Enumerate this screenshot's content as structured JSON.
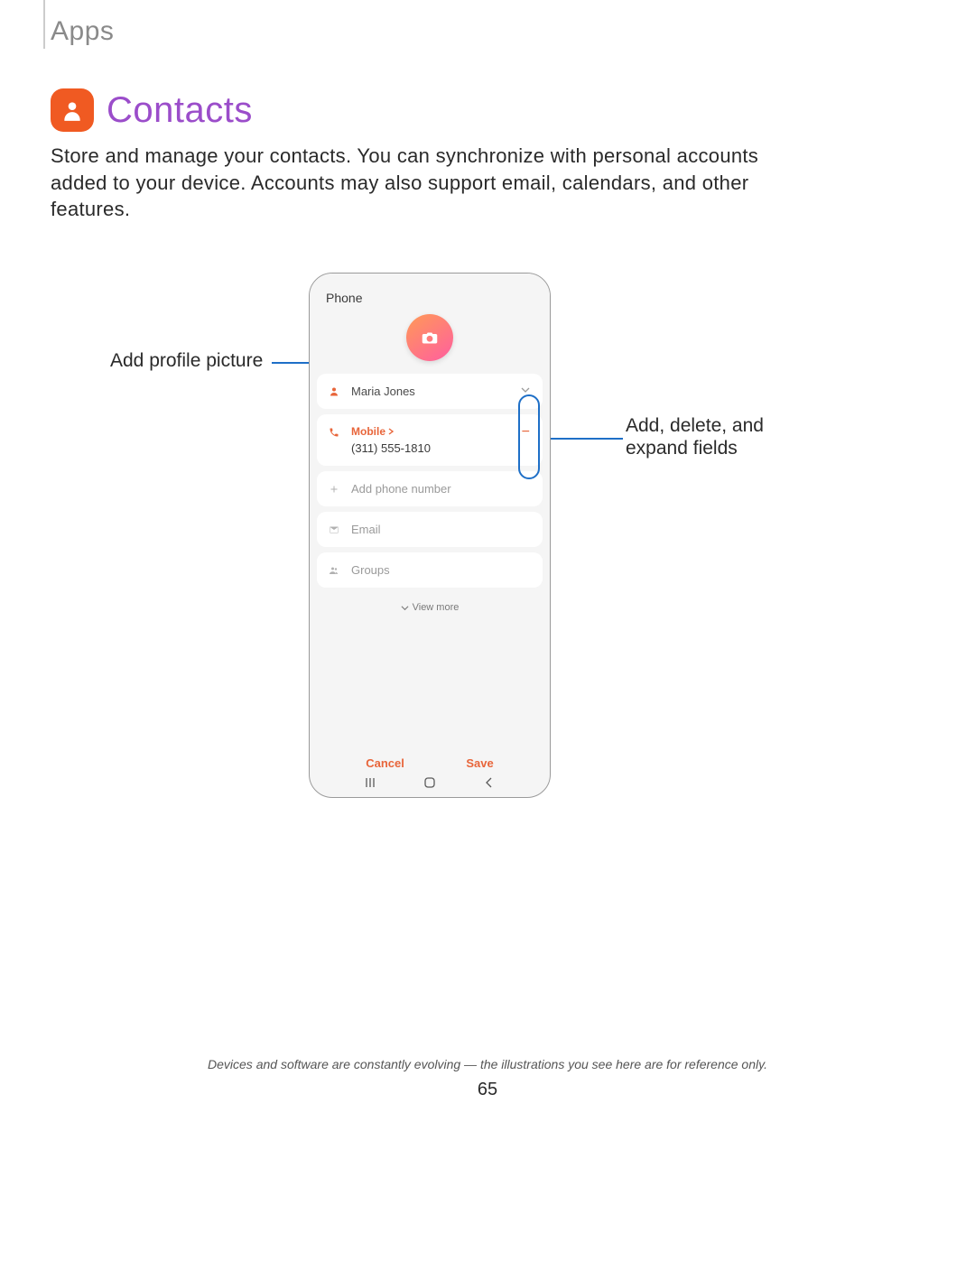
{
  "section": "Apps",
  "title": "Contacts",
  "intro": "Store and manage your contacts. You can synchronize with personal accounts added to your device. Accounts may also support email, calendars, and other features.",
  "callouts": {
    "left": "Add profile picture",
    "right": "Add, delete, and expand fields"
  },
  "phone": {
    "storage_label": "Phone",
    "name_value": "Maria Jones",
    "phone_type": "Mobile",
    "phone_number": "(311) 555-1810",
    "add_phone": "Add phone number",
    "email": "Email",
    "groups": "Groups",
    "view_more": "View more",
    "cancel": "Cancel",
    "save": "Save"
  },
  "footer": "Devices and software are constantly evolving — the illustrations you see here are for reference only.",
  "page_number": "65"
}
